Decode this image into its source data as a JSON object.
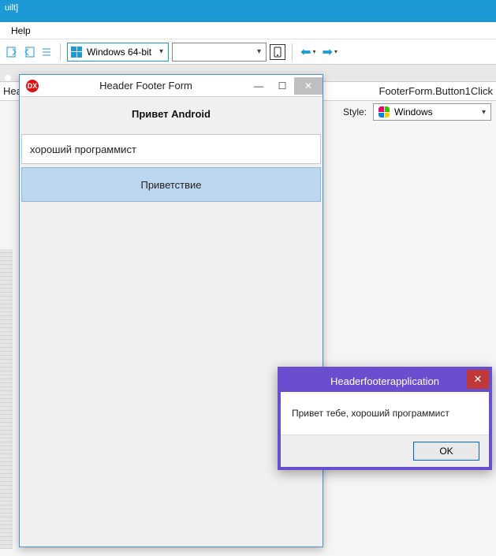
{
  "ide": {
    "title_fragment": "uilt]",
    "menu": {
      "help": "Help"
    },
    "toolbar": {
      "platform_label": "Windows 64-bit",
      "nav_back_tooltip": "Back",
      "nav_fwd_tooltip": "Forward"
    },
    "breadcrumb_left_fragment": "Hea",
    "breadcrumb_right_fragment": "FooterForm.Button1Click",
    "style": {
      "label": "Style:",
      "value": "Windows"
    }
  },
  "form": {
    "title": "Header Footer Form",
    "header_label": "Привет Android",
    "input_value": "хороший программист",
    "button_label": "Приветствие"
  },
  "dialog": {
    "title": "Headerfooterapplication",
    "message": "Привет тебе, хороший программист",
    "ok_label": "OK"
  }
}
